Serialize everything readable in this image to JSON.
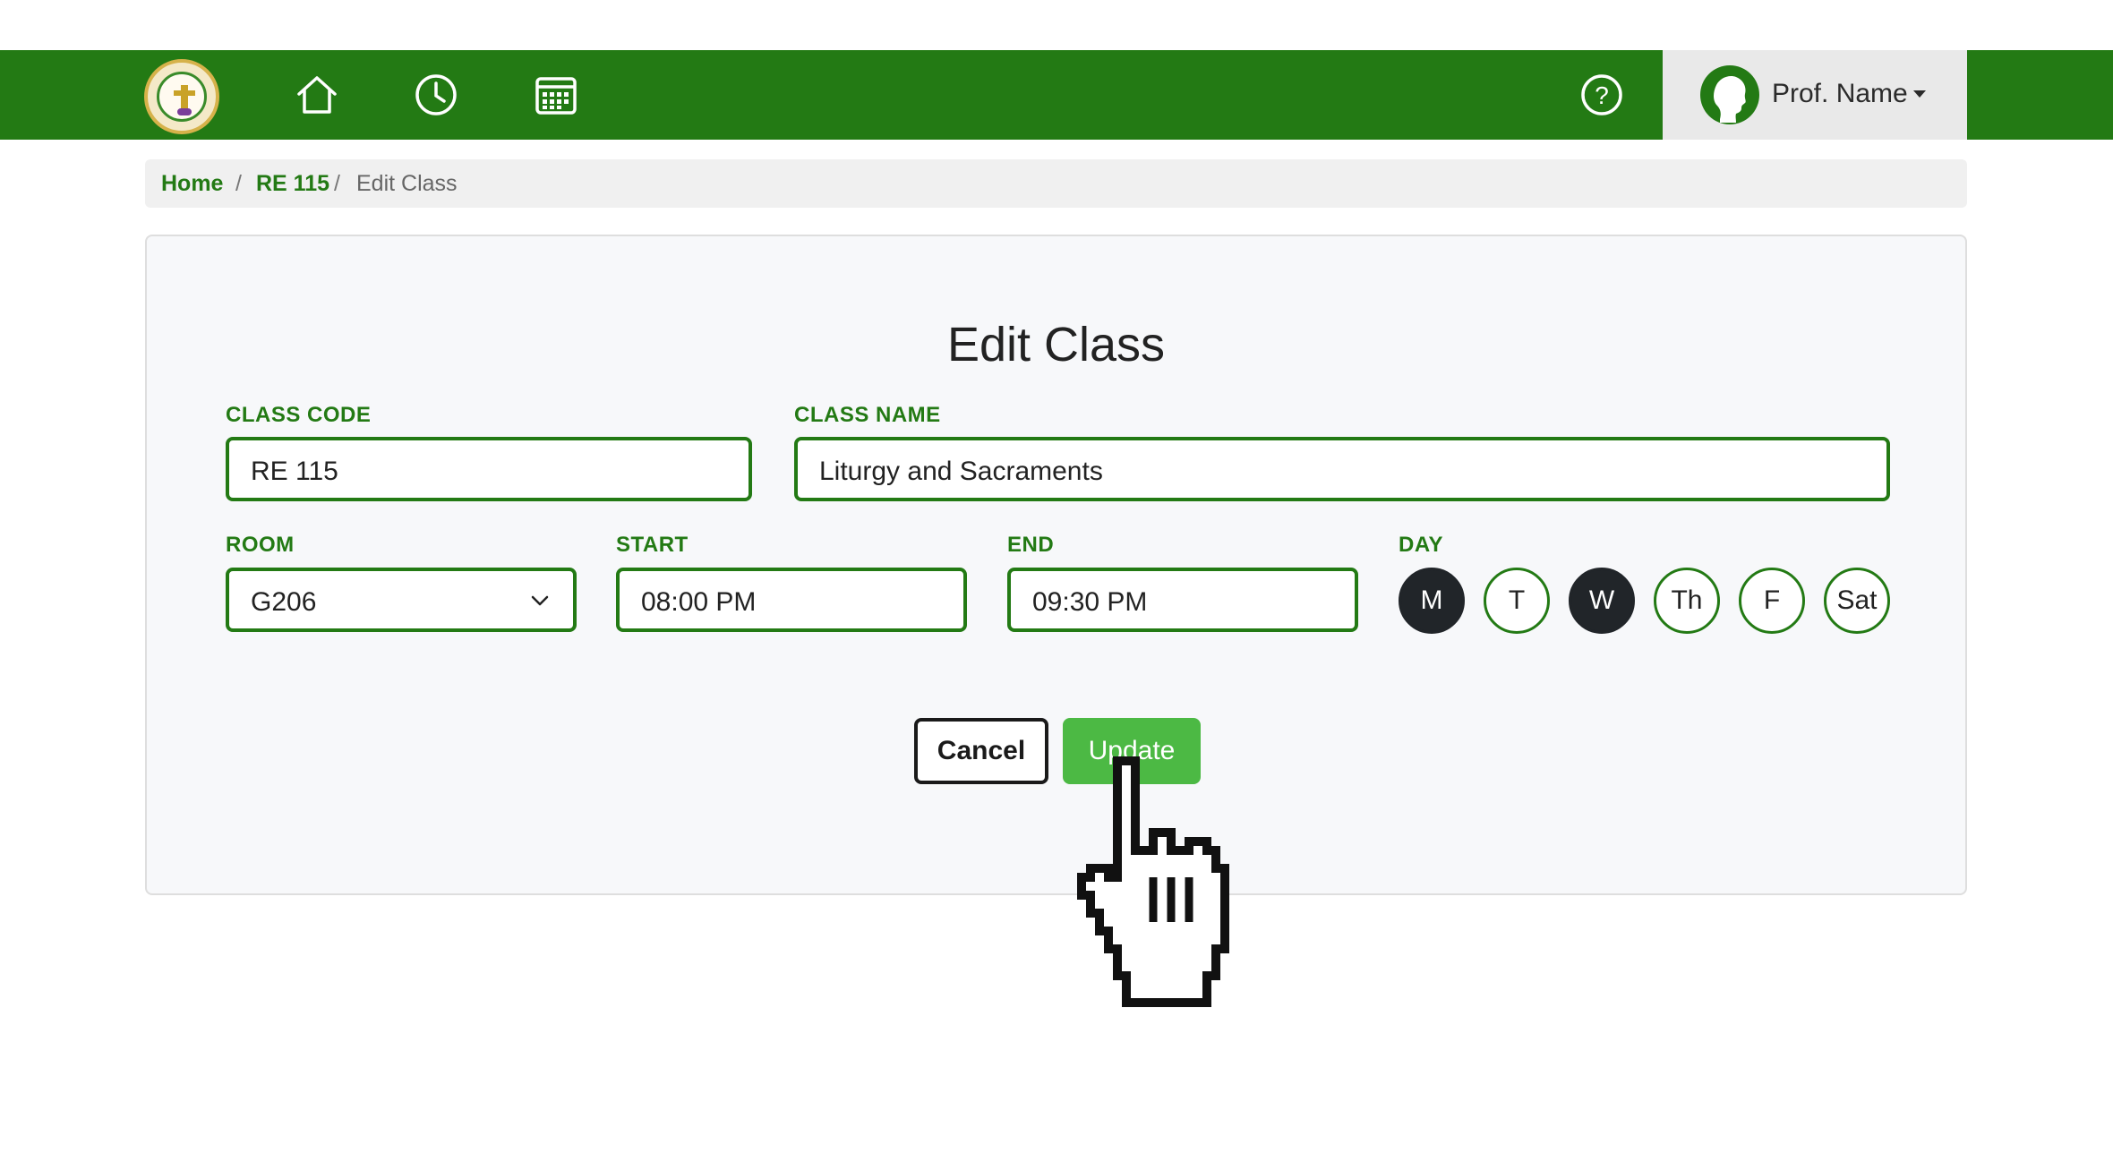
{
  "navbar": {
    "logo_alt": "",
    "home_icon": "home-icon",
    "history_icon": "clock-icon",
    "calendar_icon": "calendar-icon",
    "help_icon": "help-icon",
    "user_name": "Prof. Name",
    "colors": {
      "primary": "#237a14",
      "user_box_bg": "#e9e9e9"
    }
  },
  "breadcrumb": {
    "home": "Home",
    "sep1": "/",
    "course": "RE 115",
    "sep2": "/",
    "current": "Edit Class"
  },
  "form": {
    "title": "Edit Class",
    "class_code": {
      "label": "CLASS CODE",
      "value": "RE 115"
    },
    "class_name": {
      "label": "CLASS NAME",
      "value": "Liturgy and Sacraments"
    },
    "room": {
      "label": "ROOM",
      "value": "G206"
    },
    "start": {
      "label": "START",
      "value": "08:00 PM"
    },
    "end": {
      "label": "END",
      "value": "09:30 PM"
    },
    "day": {
      "label": "DAY",
      "options": [
        {
          "label": "M",
          "selected": true
        },
        {
          "label": "T",
          "selected": false
        },
        {
          "label": "W",
          "selected": true
        },
        {
          "label": "Th",
          "selected": false
        },
        {
          "label": "F",
          "selected": false
        },
        {
          "label": "Sat",
          "selected": false
        }
      ]
    },
    "cancel_label": "Cancel",
    "update_label": "Update",
    "colors": {
      "update_bg": "#4cb944",
      "selected_day_bg": "#212529"
    }
  }
}
